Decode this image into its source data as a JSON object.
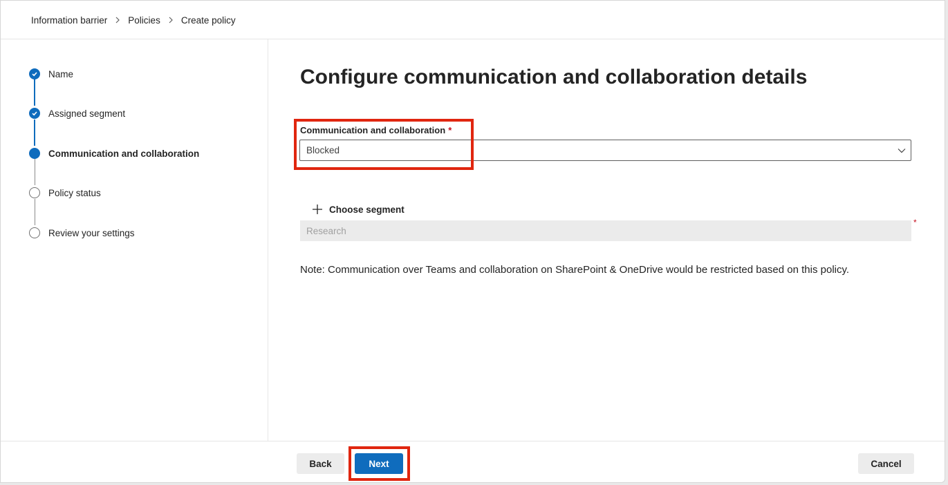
{
  "breadcrumb": {
    "items": [
      "Information barrier",
      "Policies",
      "Create policy"
    ]
  },
  "steps": [
    {
      "label": "Name",
      "state": "done"
    },
    {
      "label": "Assigned segment",
      "state": "done"
    },
    {
      "label": "Communication and collaboration",
      "state": "current"
    },
    {
      "label": "Policy status",
      "state": "todo"
    },
    {
      "label": "Review your settings",
      "state": "todo"
    }
  ],
  "main": {
    "title": "Configure communication and collaboration details",
    "field": {
      "label": "Communication and collaboration",
      "required_marker": "*",
      "value": "Blocked"
    },
    "choose_segment_label": "Choose segment",
    "segment": {
      "placeholder": "Research",
      "required_marker": "*"
    },
    "note": "Note: Communication over Teams and collaboration on SharePoint & OneDrive would be restricted based on this policy."
  },
  "footer": {
    "back_label": "Back",
    "next_label": "Next",
    "cancel_label": "Cancel"
  },
  "colors": {
    "accent": "#0f6cbd",
    "highlight": "#e0260f",
    "required": "#c50f1f"
  },
  "icons": {
    "breadcrumb_separator": "chevron-right-icon",
    "step_done": "checkmark-circle-icon",
    "step_current": "filled-circle-icon",
    "step_todo": "empty-circle-icon",
    "dropdown": "chevron-down-icon",
    "add": "plus-icon"
  }
}
